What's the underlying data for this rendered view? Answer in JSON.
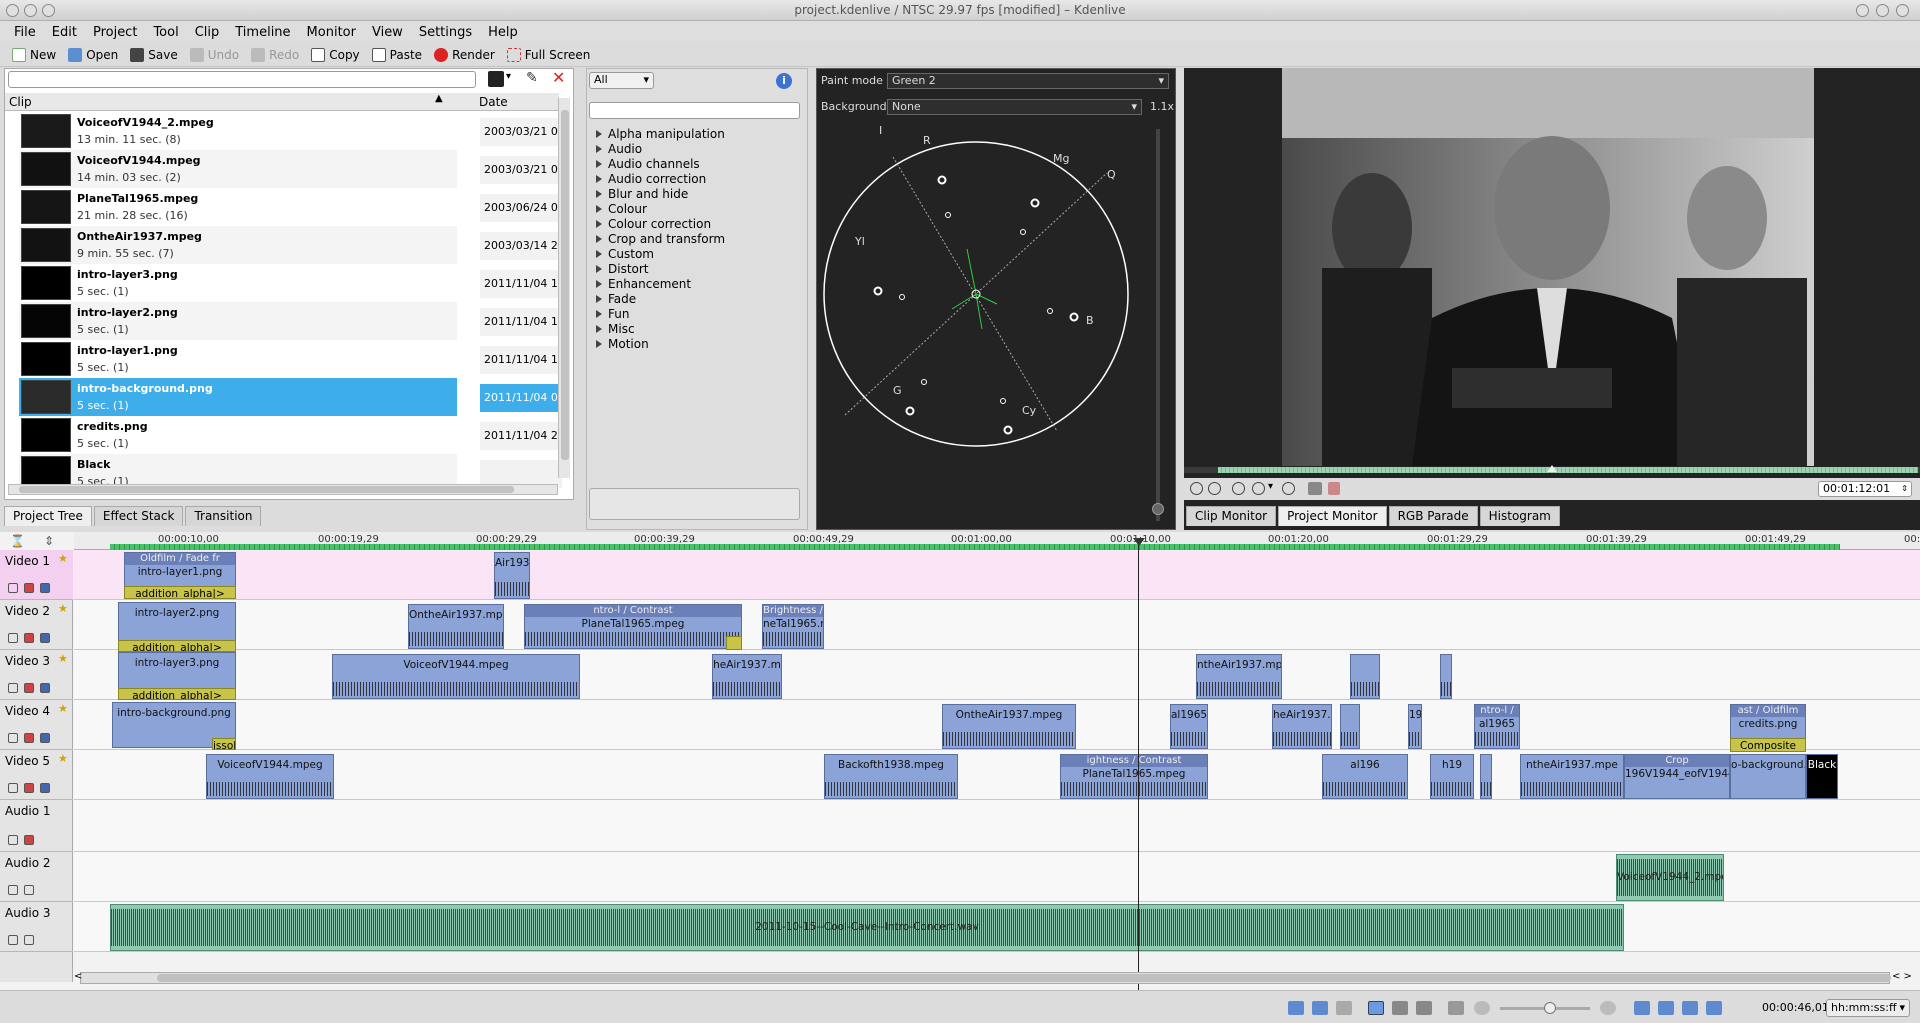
{
  "window": {
    "title": "project.kdenlive / NTSC 29.97 fps [modified] – Kdenlive"
  },
  "menu": [
    "File",
    "Edit",
    "Project",
    "Tool",
    "Clip",
    "Timeline",
    "Monitor",
    "View",
    "Settings",
    "Help"
  ],
  "toolbar": {
    "new": "New",
    "open": "Open",
    "save": "Save",
    "undo": "Undo",
    "redo": "Redo",
    "copy": "Copy",
    "paste": "Paste",
    "render": "Render",
    "fullscreen": "Full Screen"
  },
  "bin": {
    "col_clip": "Clip",
    "col_date": "Date",
    "items": [
      {
        "name": "VoiceofV1944_2.mpeg",
        "info": "13 min. 11 sec. (8)",
        "date": "2003/03/21 0"
      },
      {
        "name": "VoiceofV1944.mpeg",
        "info": "14 min. 03 sec. (2)",
        "date": "2003/03/21 0"
      },
      {
        "name": "PlaneTal1965.mpeg",
        "info": "21 min. 28 sec. (16)",
        "date": "2003/06/24 0"
      },
      {
        "name": "OntheAir1937.mpeg",
        "info": "9 min. 55 sec. (7)",
        "date": "2003/03/14 2"
      },
      {
        "name": "intro-layer3.png",
        "info": "5 sec. (1)",
        "date": "2011/11/04 1"
      },
      {
        "name": "intro-layer2.png",
        "info": "5 sec. (1)",
        "date": "2011/11/04 1"
      },
      {
        "name": "intro-layer1.png",
        "info": "5 sec. (1)",
        "date": "2011/11/04 1"
      },
      {
        "name": "intro-background.png",
        "info": "5 sec. (1)",
        "date": "2011/11/04 0"
      },
      {
        "name": "credits.png",
        "info": "5 sec. (1)",
        "date": "2011/11/04 2"
      },
      {
        "name": "Black",
        "info": "5 sec. (1)",
        "date": ""
      }
    ]
  },
  "panel_tabs": {
    "project_tree": "Project Tree",
    "effect_stack": "Effect Stack",
    "transition": "Transition"
  },
  "effects": {
    "filter": "All",
    "categories": [
      "Alpha manipulation",
      "Audio",
      "Audio channels",
      "Audio correction",
      "Blur and hide",
      "Colour",
      "Colour correction",
      "Crop and transform",
      "Custom",
      "Distort",
      "Enhancement",
      "Fade",
      "Fun",
      "Misc",
      "Motion"
    ]
  },
  "scope": {
    "paint_label": "Paint mode",
    "paint_value": "Green 2",
    "bg_label": "Background",
    "bg_value": "None",
    "zoom": "1.1x",
    "labels": {
      "i": "I",
      "r": "R",
      "mg": "Mg",
      "q": "Q",
      "yl": "Yl",
      "b": "B",
      "g": "G",
      "cy": "Cy"
    }
  },
  "monitor": {
    "timecode": "00:01:12:01",
    "tabs": [
      "Clip Monitor",
      "Project Monitor",
      "RGB Parade",
      "Histogram"
    ]
  },
  "ruler": [
    "00:00:10,00",
    "00:00:19,29",
    "00:00:29,29",
    "00:00:39,29",
    "00:00:49,29",
    "00:01:00,00",
    "00:01:10,00",
    "00:01:20,00",
    "00:01:29,29",
    "00:01:39,29",
    "00:01:49,29",
    "00:01:5"
  ],
  "tracks": [
    "Video 1",
    "Video 2",
    "Video 3",
    "Video 4",
    "Video 5",
    "Audio 1",
    "Audio 2",
    "Audio 3"
  ],
  "clips": {
    "v1a": "intro-layer1.png",
    "v1b": "Air193",
    "v1t": "Oldfilm / Fade fr",
    "t1": "addition_alpha|>",
    "t2": "addition_alpha|>",
    "t3": "addition_alpha|>",
    "v2a": "intro-layer2.png",
    "v2b": "OntheAir1937.mpeg",
    "v2c": "PlaneTal1965.mpeg",
    "v2ce": "ntro-l / Contrast",
    "v2d": "neTal1965.m",
    "v2de": "Brightness /",
    "v3a": "intro-layer3.png",
    "v3b": "VoiceofV1944.mpeg",
    "v3c": "heAir1937.m",
    "v3d": "ntheAir1937.mpe",
    "v4a": "intro-background.png",
    "v4b": "OntheAir1937.mpeg",
    "v4c": "al1965",
    "v4d": "heAir1937.m",
    "v4e": "196",
    "v4f": "al1965",
    "v4fe": "ntro-l /",
    "v4g": "credits.png",
    "v4ge": "ast / Oldfilm",
    "v4h": "Composite",
    "v5a": "VoiceofV1944.mpeg",
    "v5b": "Backofth1938.mpeg",
    "v5c": "PlaneTal1965.mpeg",
    "v5ce": "ightness / Contrast",
    "v5d": "al196",
    "v5e": "h19",
    "v5f": "ntheAir1937.mpe",
    "v5g": "196V1944_eofV1944_2.m",
    "v5ge": "Crop",
    "v5h": "o-background.",
    "v5i": "Black",
    "tr_issol": "issol",
    "tr_ssol": "ssol",
    "tr_so": "so",
    "a2": "VoiceofV1944_2.mpeg",
    "a3": "2011-10-15--Cool-Cave--Intro-Concert.wav"
  },
  "status": {
    "time": "00:00:46,01",
    "format": "hh:mm:ss:ff"
  },
  "colors": {
    "selection": "#3daee9",
    "video_clip": "#8ba3d6",
    "audio_clip": "#8fc9b2",
    "transition": "#c8c44a",
    "video1_bg": "#fbe4f6"
  }
}
